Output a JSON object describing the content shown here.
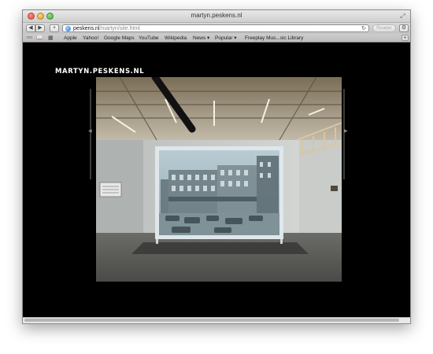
{
  "window": {
    "title": "martyn.peskens.nl"
  },
  "toolbar": {
    "back_icon": "back-arrow-icon",
    "forward_icon": "forward-arrow-icon",
    "add_icon": "plus-icon",
    "url_host": "peskens.nl",
    "url_path": "/martyn/site.html",
    "reader_label": "Reader",
    "reload_icon": "reload-icon",
    "settings_icon": "gear-icon"
  },
  "bookmarks": {
    "items": [
      {
        "label": "Apple"
      },
      {
        "label": "Yahoo!"
      },
      {
        "label": "Google Maps"
      },
      {
        "label": "YouTube"
      },
      {
        "label": "Wikipedia"
      },
      {
        "label": "News ▾"
      },
      {
        "label": "Popular ▾"
      },
      {
        "label": "Freeplay Mus...sic Library"
      }
    ]
  },
  "page": {
    "site_title": "MARTYN.PESKENS.NL",
    "photo_subject": "gallery installation: framed projection screen showing a street-corner building photo"
  },
  "colors": {
    "page_background": "#000000",
    "title_text": "#ffffff",
    "chrome": "#c9c9c9"
  }
}
